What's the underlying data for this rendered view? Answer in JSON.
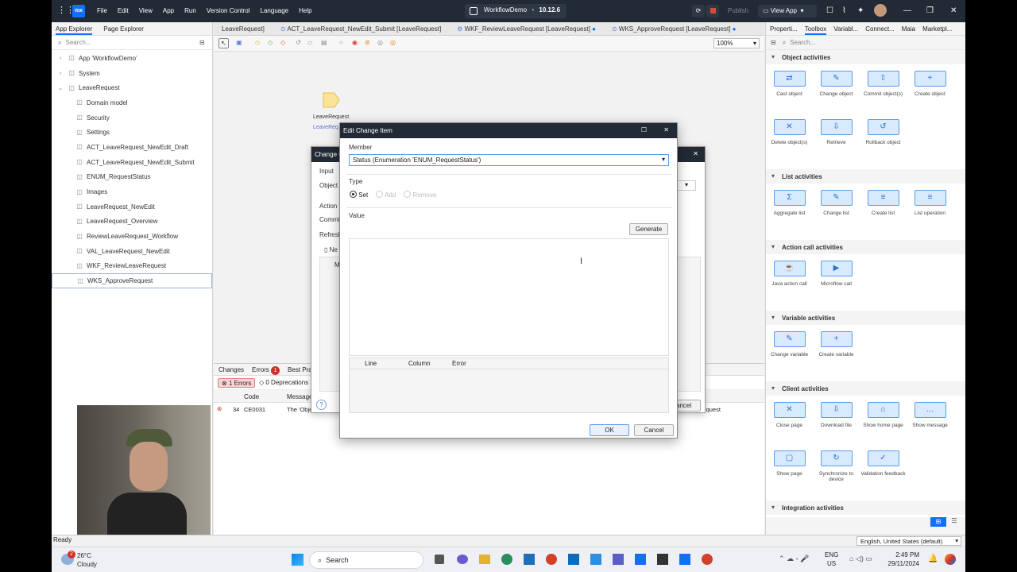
{
  "titlebar": {
    "menu": [
      "File",
      "Edit",
      "View",
      "App",
      "Run",
      "Version Control",
      "Language",
      "Help"
    ],
    "app_name": "WorkflowDemo",
    "version": "10.12.6",
    "publish": "Publish",
    "view_app": "View App"
  },
  "left_panel": {
    "tabs": [
      "App Explorer",
      "Page Explorer"
    ],
    "search_placeholder": "Search...",
    "tree": [
      {
        "label": "App 'WorkflowDemo'",
        "level": 0,
        "arrow": "›",
        "icon": "app-icon"
      },
      {
        "label": "System",
        "level": 0,
        "arrow": "›",
        "icon": "module-icon"
      },
      {
        "label": "LeaveRequest",
        "level": 0,
        "arrow": "⌄",
        "icon": "module-icon"
      },
      {
        "label": "Domain model",
        "level": 1,
        "icon": "domain-model-icon"
      },
      {
        "label": "Security",
        "level": 1,
        "icon": "security-icon"
      },
      {
        "label": "Settings",
        "level": 1,
        "icon": "settings-icon"
      },
      {
        "label": "ACT_LeaveRequest_NewEdit_Draft",
        "level": 1,
        "icon": "microflow-icon"
      },
      {
        "label": "ACT_LeaveRequest_NewEdit_Submit",
        "level": 1,
        "icon": "microflow-icon"
      },
      {
        "label": "ENUM_RequestStatus",
        "level": 1,
        "icon": "enumeration-icon"
      },
      {
        "label": "Images",
        "level": 1,
        "icon": "images-icon"
      },
      {
        "label": "LeaveRequest_NewEdit",
        "level": 1,
        "icon": "page-icon"
      },
      {
        "label": "LeaveRequest_Overview",
        "level": 1,
        "icon": "page-icon"
      },
      {
        "label": "ReviewLeaveRequest_Workflow",
        "level": 1,
        "icon": "page-icon"
      },
      {
        "label": "VAL_LeaveRequest_NewEdit",
        "level": 1,
        "icon": "microflow-icon"
      },
      {
        "label": "WKF_ReviewLeaveRequest",
        "level": 1,
        "icon": "workflow-icon"
      },
      {
        "label": "WKS_ApproveRequest",
        "level": 1,
        "icon": "microflow-icon",
        "selected": true
      }
    ]
  },
  "editor": {
    "tabs": [
      {
        "label": "LeaveRequest]",
        "dot": false
      },
      {
        "label": "ACT_LeaveRequest_NewEdit_Submit [LeaveRequest]",
        "dot": false
      },
      {
        "label": "WKF_ReviewLeaveRequest [LeaveRequest]",
        "dot": true
      },
      {
        "label": "WKS_ApproveRequest [LeaveRequest]",
        "dot": true
      }
    ],
    "zoom": "100%",
    "canvas_param_label": "LeaveRequest",
    "canvas_param_sub": "LeaveReq",
    "bottom_tabs": [
      "Changes",
      "Errors",
      "Best Pra"
    ],
    "error_count": "1",
    "errors_chip": "1 Errors",
    "deprecations_chip": "0 Deprecations",
    "error_table": {
      "headers": [
        "Code",
        "Message"
      ],
      "rows": [
        {
          "line": "34",
          "code": "CE0031",
          "message": "The 'Object' property",
          "tail": "Request"
        }
      ]
    }
  },
  "back_dialog": {
    "title": "Change O",
    "input_label": "Input",
    "object_label": "Object",
    "action_label": "Action",
    "commit_label": "Commi",
    "refresh_label": "Refresh",
    "new_label": "Ne",
    "col_label": "M",
    "cancel": "ancel"
  },
  "dialog": {
    "title": "Edit Change Item",
    "member_label": "Member",
    "member_value": "Status (Enumeration 'ENUM_RequestStatus')",
    "type_label": "Type",
    "type_options": [
      "Set",
      "Add",
      "Remove"
    ],
    "value_label": "Value",
    "generate": "Generate",
    "error_headers": [
      "Line",
      "Column",
      "Error"
    ],
    "ok": "OK",
    "cancel": "Cancel"
  },
  "right_panel": {
    "tabs": [
      "Properti...",
      "Toolbox",
      "Variabl...",
      "Connect...",
      "Maia",
      "Marketpl..."
    ],
    "search_placeholder": "Search...",
    "sections": [
      {
        "title": "Object activities",
        "items": [
          {
            "label": "Cast object",
            "icon": "cast-object-icon",
            "glyph": "⇄"
          },
          {
            "label": "Change object",
            "icon": "change-object-icon",
            "glyph": "✎"
          },
          {
            "label": "Commit object(s)",
            "icon": "commit-object-icon",
            "glyph": "⇧"
          },
          {
            "label": "Create object",
            "icon": "create-object-icon",
            "glyph": "+"
          },
          {
            "label": "Delete object(s)",
            "icon": "delete-object-icon",
            "glyph": "✕"
          },
          {
            "label": "Retrieve",
            "icon": "retrieve-icon",
            "glyph": "⇩"
          },
          {
            "label": "Rollback object",
            "icon": "rollback-object-icon",
            "glyph": "↺"
          }
        ]
      },
      {
        "title": "List activities",
        "items": [
          {
            "label": "Aggregate list",
            "icon": "aggregate-list-icon",
            "glyph": "Σ"
          },
          {
            "label": "Change list",
            "icon": "change-list-icon",
            "glyph": "✎"
          },
          {
            "label": "Create list",
            "icon": "create-list-icon",
            "glyph": "≡"
          },
          {
            "label": "List operation",
            "icon": "list-operation-icon",
            "glyph": "≡"
          }
        ]
      },
      {
        "title": "Action call activities",
        "items": [
          {
            "label": "Java action call",
            "icon": "java-action-icon",
            "glyph": "☕"
          },
          {
            "label": "Microflow call",
            "icon": "microflow-call-icon",
            "glyph": "▶"
          }
        ]
      },
      {
        "title": "Variable activities",
        "items": [
          {
            "label": "Change variable",
            "icon": "change-variable-icon",
            "glyph": "✎"
          },
          {
            "label": "Create variable",
            "icon": "create-variable-icon",
            "glyph": "+"
          }
        ]
      },
      {
        "title": "Client activities",
        "items": [
          {
            "label": "Close page",
            "icon": "close-page-icon",
            "glyph": "✕"
          },
          {
            "label": "Download file",
            "icon": "download-file-icon",
            "glyph": "⇩"
          },
          {
            "label": "Show home page",
            "icon": "home-page-icon",
            "glyph": "⌂"
          },
          {
            "label": "Show message",
            "icon": "message-icon",
            "glyph": "…"
          },
          {
            "label": "Show page",
            "icon": "show-page-icon",
            "glyph": "▢"
          },
          {
            "label": "Synchronize to device",
            "icon": "sync-icon",
            "glyph": "↻"
          },
          {
            "label": "Validation feedback",
            "icon": "validation-icon",
            "glyph": "✓"
          }
        ]
      },
      {
        "title": "Integration activities",
        "items": [
          {
            "label": "",
            "icon": "call-rest-icon",
            "glyph": "▶"
          },
          {
            "label": "",
            "icon": "import-mapping-icon",
            "glyph": "[ ]"
          },
          {
            "label": "",
            "icon": "web-service-icon",
            "glyph": "⊕"
          },
          {
            "label": "",
            "icon": "export-mapping-icon",
            "glyph": "▤"
          }
        ]
      }
    ]
  },
  "statusbar": {
    "left": "Ready",
    "language": "English, United States (default)"
  },
  "taskbar": {
    "weather_temp": "26°C",
    "weather_desc": "Cloudy",
    "weather_badge": "2",
    "search": "Search",
    "lang": "ENG",
    "region": "US",
    "time": "2:49 PM",
    "date": "29/11/2024"
  }
}
